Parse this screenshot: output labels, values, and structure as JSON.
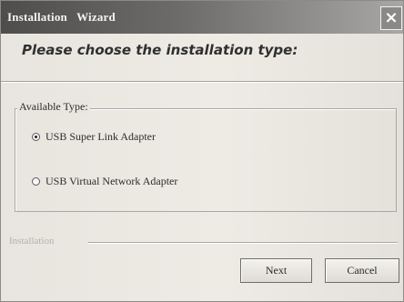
{
  "window": {
    "title": "Installation   Wizard",
    "close_glyph": "×"
  },
  "header": {
    "heading": "Please choose the installation type:"
  },
  "type_group": {
    "legend": "Available Type:",
    "options": [
      {
        "label": "USB Super Link Adapter",
        "checked": true
      },
      {
        "label": "USB Virtual Network Adapter",
        "checked": false
      }
    ]
  },
  "footer": {
    "section_label": "Installation",
    "next_label": "Next",
    "cancel_label": "Cancel"
  },
  "icons": {
    "close": "close-icon"
  }
}
